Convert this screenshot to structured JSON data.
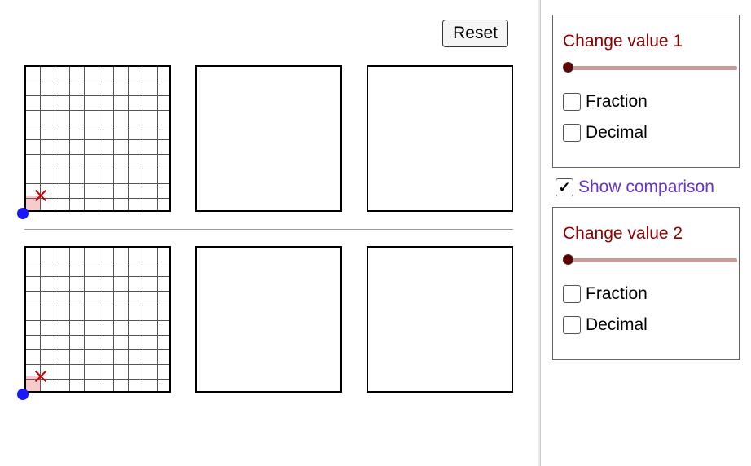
{
  "toolbar": {
    "reset_label": "Reset"
  },
  "panel1": {
    "title": "Change value 1",
    "fraction_label": "Fraction",
    "decimal_label": "Decimal",
    "fraction_checked": false,
    "decimal_checked": false,
    "slider_value": 0
  },
  "comparison": {
    "label": "Show comparison",
    "checked": true
  },
  "panel2": {
    "title": "Change value 2",
    "fraction_label": "Fraction",
    "decimal_label": "Decimal",
    "fraction_checked": false,
    "decimal_checked": false,
    "slider_value": 0
  },
  "grids": {
    "row1": {
      "gridded_index": 0,
      "shaded_cells": 1
    },
    "row2": {
      "gridded_index": 0,
      "shaded_cells": 1
    }
  }
}
